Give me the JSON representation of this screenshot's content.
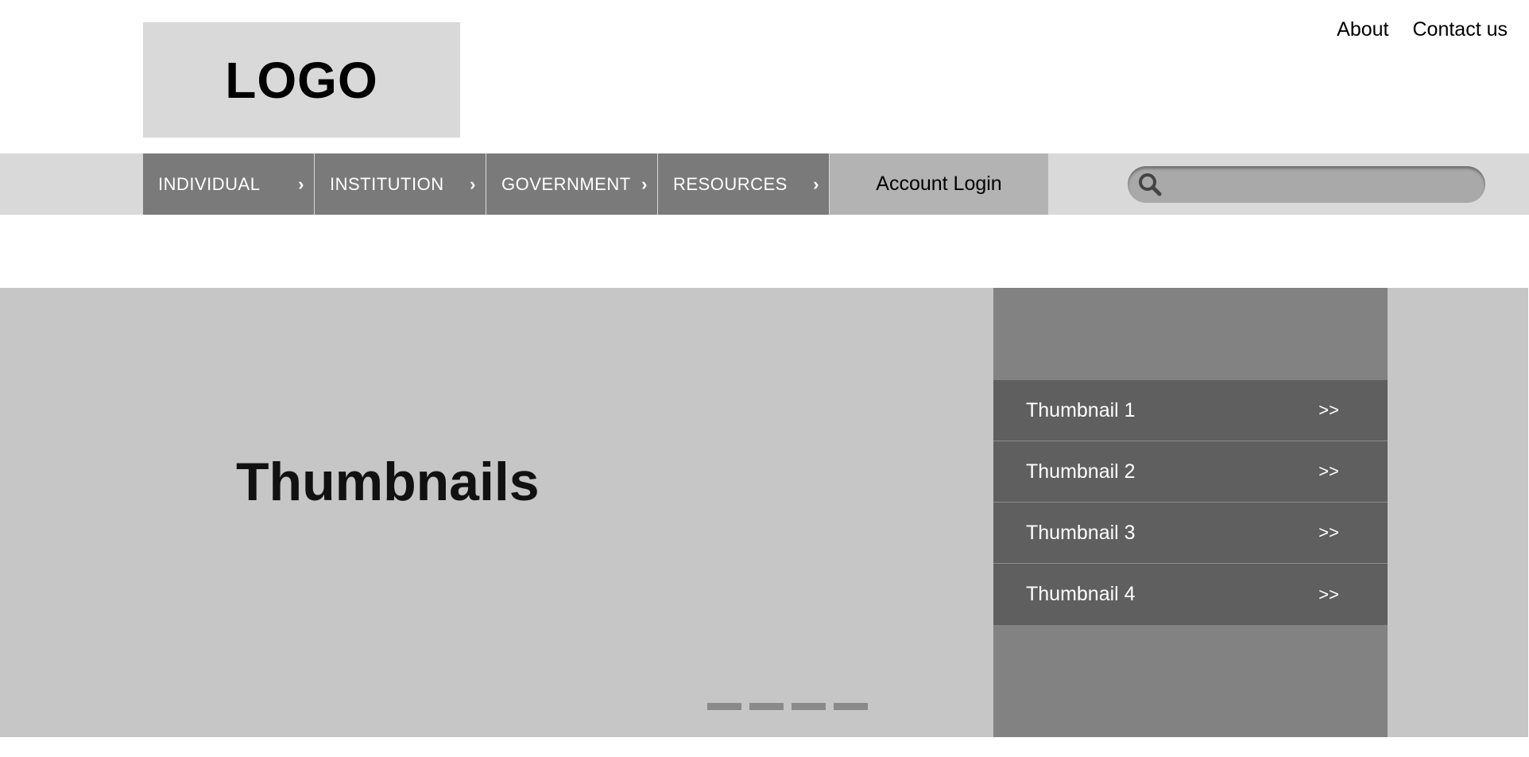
{
  "logo": {
    "text": "LOGO"
  },
  "top_links": {
    "about": "About",
    "contact": "Contact us"
  },
  "nav": {
    "items": [
      {
        "label": "INDIVIDUAL",
        "chevron": "›"
      },
      {
        "label": "INSTITUTION",
        "chevron": "›"
      },
      {
        "label": "GOVERNMENT",
        "chevron": "›"
      },
      {
        "label": "RESOURCES",
        "chevron": "›"
      }
    ],
    "account_login": "Account Login"
  },
  "search": {
    "placeholder": "",
    "icon": "search-icon"
  },
  "hero": {
    "title": "Thumbnails",
    "thumbnails": [
      {
        "label": "Thumbnail 1",
        "arrow": ">>"
      },
      {
        "label": "Thumbnail 2",
        "arrow": ">>"
      },
      {
        "label": "Thumbnail 3",
        "arrow": ">>"
      },
      {
        "label": "Thumbnail 4",
        "arrow": ">>"
      }
    ],
    "carousel_count": 4
  },
  "colors": {
    "nav_bg": "#7a7a7a",
    "navbar_bg": "#d9d9d9",
    "account_bg": "#b3b3b3",
    "hero_bg": "#c6c6c6",
    "panel_bg": "#828282",
    "thumb_bg": "#5f5f5f"
  }
}
